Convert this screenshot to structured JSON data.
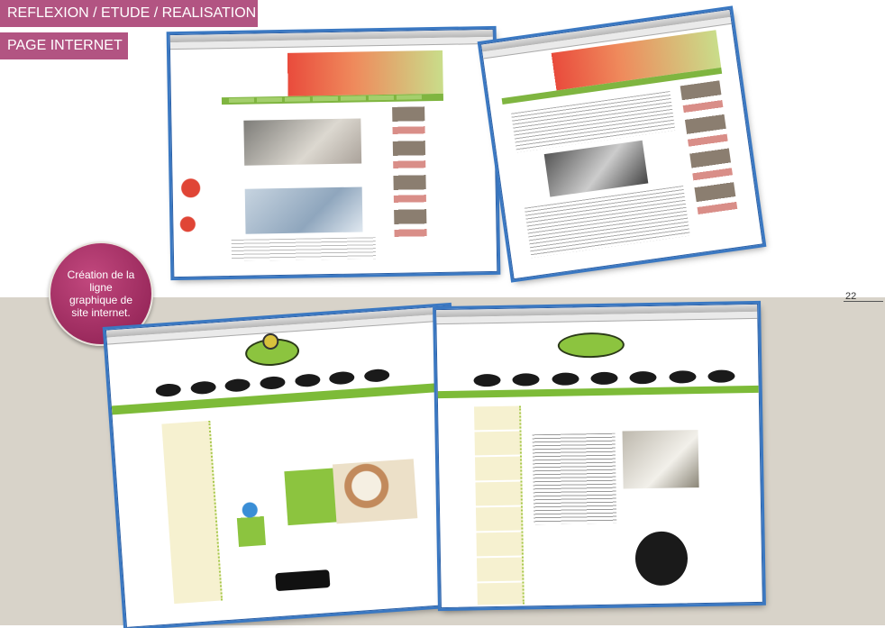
{
  "header": {
    "title": "REFLEXION / ETUDE / REALISATION",
    "subtitle": "PAGE INTERNET"
  },
  "circle_label": "Création de la ligne graphique de site internet.",
  "page_number": "22",
  "colors": {
    "accent": "#b25482",
    "background_lower": "#d8d3c9",
    "frame": "#3a78c2"
  }
}
